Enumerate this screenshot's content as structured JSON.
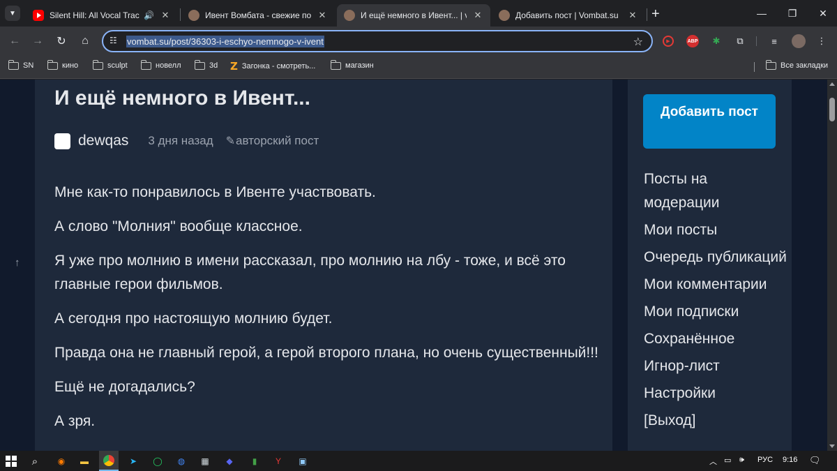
{
  "browser": {
    "tabs": [
      {
        "title": "Silent Hill: All Vocal Tracks -",
        "favicon": "youtube-icon",
        "sound": true,
        "active": false
      },
      {
        "title": "Ивент Вомбата - свежие пост",
        "favicon": "vombat-icon",
        "active": false
      },
      {
        "title": "И ещё немного в Ивент... | vom",
        "favicon": "vombat-icon",
        "active": true
      },
      {
        "title": "Добавить пост | Vombat.su",
        "favicon": "vombat-icon",
        "active": false
      }
    ],
    "url": "vombat.su/post/36303-i-eschyo-nemnogo-v-ivent",
    "abp_label": "ABP",
    "bookmarks": [
      {
        "label": "SN",
        "icon": "folder-icon"
      },
      {
        "label": "кино",
        "icon": "folder-icon"
      },
      {
        "label": "sculpt",
        "icon": "folder-icon"
      },
      {
        "label": "новелл",
        "icon": "folder-icon"
      },
      {
        "label": "3d",
        "icon": "folder-icon"
      },
      {
        "label": "Загонка - смотреть...",
        "icon": "zagonka-icon"
      },
      {
        "label": "магазин",
        "icon": "folder-icon"
      }
    ],
    "all_bookmarks_label": "Все закладки"
  },
  "post": {
    "title": "И ещё немного в Ивент...",
    "author": "dewqas",
    "date": "3 дня назад",
    "kind": "авторский пост",
    "paragraphs": [
      "Мне как-то понравилось в Ивенте участвовать.",
      "А слово \"Молния\" вообще классное.",
      "Я уже про молнию в имени рассказал, про молнию на лбу - тоже, и всё это главные герои фильмов.",
      "А сегодня про настоящую молнию будет.",
      "Правда она не главный герой, а герой второго плана, но очень существенный!!!",
      "Ещё не догадались?",
      "А зря."
    ]
  },
  "sidebar": {
    "add_post_label": "Добавить пост",
    "menu": [
      "Посты на модерации",
      "Мои посты",
      "Очередь публикаций",
      "Мои комментарии",
      "Мои подписки",
      "Сохранённое",
      "Игнор-лист",
      "Настройки",
      "[Выход]"
    ]
  },
  "taskbar": {
    "language": "РУС",
    "time": "9:16"
  },
  "colors": {
    "page_bg": "#111a2c",
    "card_bg": "#1e293b",
    "accent_button": "#0284c7",
    "text": "#e5e7eb",
    "muted": "#9ca3af"
  }
}
